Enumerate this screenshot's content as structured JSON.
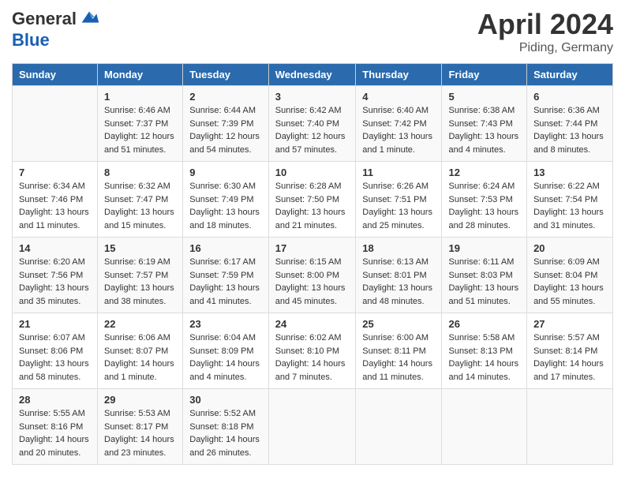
{
  "header": {
    "logo_general": "General",
    "logo_blue": "Blue",
    "month": "April 2024",
    "location": "Piding, Germany"
  },
  "weekdays": [
    "Sunday",
    "Monday",
    "Tuesday",
    "Wednesday",
    "Thursday",
    "Friday",
    "Saturday"
  ],
  "weeks": [
    [
      {
        "day": "",
        "sunrise": "",
        "sunset": "",
        "daylight": ""
      },
      {
        "day": "1",
        "sunrise": "Sunrise: 6:46 AM",
        "sunset": "Sunset: 7:37 PM",
        "daylight": "Daylight: 12 hours and 51 minutes."
      },
      {
        "day": "2",
        "sunrise": "Sunrise: 6:44 AM",
        "sunset": "Sunset: 7:39 PM",
        "daylight": "Daylight: 12 hours and 54 minutes."
      },
      {
        "day": "3",
        "sunrise": "Sunrise: 6:42 AM",
        "sunset": "Sunset: 7:40 PM",
        "daylight": "Daylight: 12 hours and 57 minutes."
      },
      {
        "day": "4",
        "sunrise": "Sunrise: 6:40 AM",
        "sunset": "Sunset: 7:42 PM",
        "daylight": "Daylight: 13 hours and 1 minute."
      },
      {
        "day": "5",
        "sunrise": "Sunrise: 6:38 AM",
        "sunset": "Sunset: 7:43 PM",
        "daylight": "Daylight: 13 hours and 4 minutes."
      },
      {
        "day": "6",
        "sunrise": "Sunrise: 6:36 AM",
        "sunset": "Sunset: 7:44 PM",
        "daylight": "Daylight: 13 hours and 8 minutes."
      }
    ],
    [
      {
        "day": "7",
        "sunrise": "Sunrise: 6:34 AM",
        "sunset": "Sunset: 7:46 PM",
        "daylight": "Daylight: 13 hours and 11 minutes."
      },
      {
        "day": "8",
        "sunrise": "Sunrise: 6:32 AM",
        "sunset": "Sunset: 7:47 PM",
        "daylight": "Daylight: 13 hours and 15 minutes."
      },
      {
        "day": "9",
        "sunrise": "Sunrise: 6:30 AM",
        "sunset": "Sunset: 7:49 PM",
        "daylight": "Daylight: 13 hours and 18 minutes."
      },
      {
        "day": "10",
        "sunrise": "Sunrise: 6:28 AM",
        "sunset": "Sunset: 7:50 PM",
        "daylight": "Daylight: 13 hours and 21 minutes."
      },
      {
        "day": "11",
        "sunrise": "Sunrise: 6:26 AM",
        "sunset": "Sunset: 7:51 PM",
        "daylight": "Daylight: 13 hours and 25 minutes."
      },
      {
        "day": "12",
        "sunrise": "Sunrise: 6:24 AM",
        "sunset": "Sunset: 7:53 PM",
        "daylight": "Daylight: 13 hours and 28 minutes."
      },
      {
        "day": "13",
        "sunrise": "Sunrise: 6:22 AM",
        "sunset": "Sunset: 7:54 PM",
        "daylight": "Daylight: 13 hours and 31 minutes."
      }
    ],
    [
      {
        "day": "14",
        "sunrise": "Sunrise: 6:20 AM",
        "sunset": "Sunset: 7:56 PM",
        "daylight": "Daylight: 13 hours and 35 minutes."
      },
      {
        "day": "15",
        "sunrise": "Sunrise: 6:19 AM",
        "sunset": "Sunset: 7:57 PM",
        "daylight": "Daylight: 13 hours and 38 minutes."
      },
      {
        "day": "16",
        "sunrise": "Sunrise: 6:17 AM",
        "sunset": "Sunset: 7:59 PM",
        "daylight": "Daylight: 13 hours and 41 minutes."
      },
      {
        "day": "17",
        "sunrise": "Sunrise: 6:15 AM",
        "sunset": "Sunset: 8:00 PM",
        "daylight": "Daylight: 13 hours and 45 minutes."
      },
      {
        "day": "18",
        "sunrise": "Sunrise: 6:13 AM",
        "sunset": "Sunset: 8:01 PM",
        "daylight": "Daylight: 13 hours and 48 minutes."
      },
      {
        "day": "19",
        "sunrise": "Sunrise: 6:11 AM",
        "sunset": "Sunset: 8:03 PM",
        "daylight": "Daylight: 13 hours and 51 minutes."
      },
      {
        "day": "20",
        "sunrise": "Sunrise: 6:09 AM",
        "sunset": "Sunset: 8:04 PM",
        "daylight": "Daylight: 13 hours and 55 minutes."
      }
    ],
    [
      {
        "day": "21",
        "sunrise": "Sunrise: 6:07 AM",
        "sunset": "Sunset: 8:06 PM",
        "daylight": "Daylight: 13 hours and 58 minutes."
      },
      {
        "day": "22",
        "sunrise": "Sunrise: 6:06 AM",
        "sunset": "Sunset: 8:07 PM",
        "daylight": "Daylight: 14 hours and 1 minute."
      },
      {
        "day": "23",
        "sunrise": "Sunrise: 6:04 AM",
        "sunset": "Sunset: 8:09 PM",
        "daylight": "Daylight: 14 hours and 4 minutes."
      },
      {
        "day": "24",
        "sunrise": "Sunrise: 6:02 AM",
        "sunset": "Sunset: 8:10 PM",
        "daylight": "Daylight: 14 hours and 7 minutes."
      },
      {
        "day": "25",
        "sunrise": "Sunrise: 6:00 AM",
        "sunset": "Sunset: 8:11 PM",
        "daylight": "Daylight: 14 hours and 11 minutes."
      },
      {
        "day": "26",
        "sunrise": "Sunrise: 5:58 AM",
        "sunset": "Sunset: 8:13 PM",
        "daylight": "Daylight: 14 hours and 14 minutes."
      },
      {
        "day": "27",
        "sunrise": "Sunrise: 5:57 AM",
        "sunset": "Sunset: 8:14 PM",
        "daylight": "Daylight: 14 hours and 17 minutes."
      }
    ],
    [
      {
        "day": "28",
        "sunrise": "Sunrise: 5:55 AM",
        "sunset": "Sunset: 8:16 PM",
        "daylight": "Daylight: 14 hours and 20 minutes."
      },
      {
        "day": "29",
        "sunrise": "Sunrise: 5:53 AM",
        "sunset": "Sunset: 8:17 PM",
        "daylight": "Daylight: 14 hours and 23 minutes."
      },
      {
        "day": "30",
        "sunrise": "Sunrise: 5:52 AM",
        "sunset": "Sunset: 8:18 PM",
        "daylight": "Daylight: 14 hours and 26 minutes."
      },
      {
        "day": "",
        "sunrise": "",
        "sunset": "",
        "daylight": ""
      },
      {
        "day": "",
        "sunrise": "",
        "sunset": "",
        "daylight": ""
      },
      {
        "day": "",
        "sunrise": "",
        "sunset": "",
        "daylight": ""
      },
      {
        "day": "",
        "sunrise": "",
        "sunset": "",
        "daylight": ""
      }
    ]
  ]
}
